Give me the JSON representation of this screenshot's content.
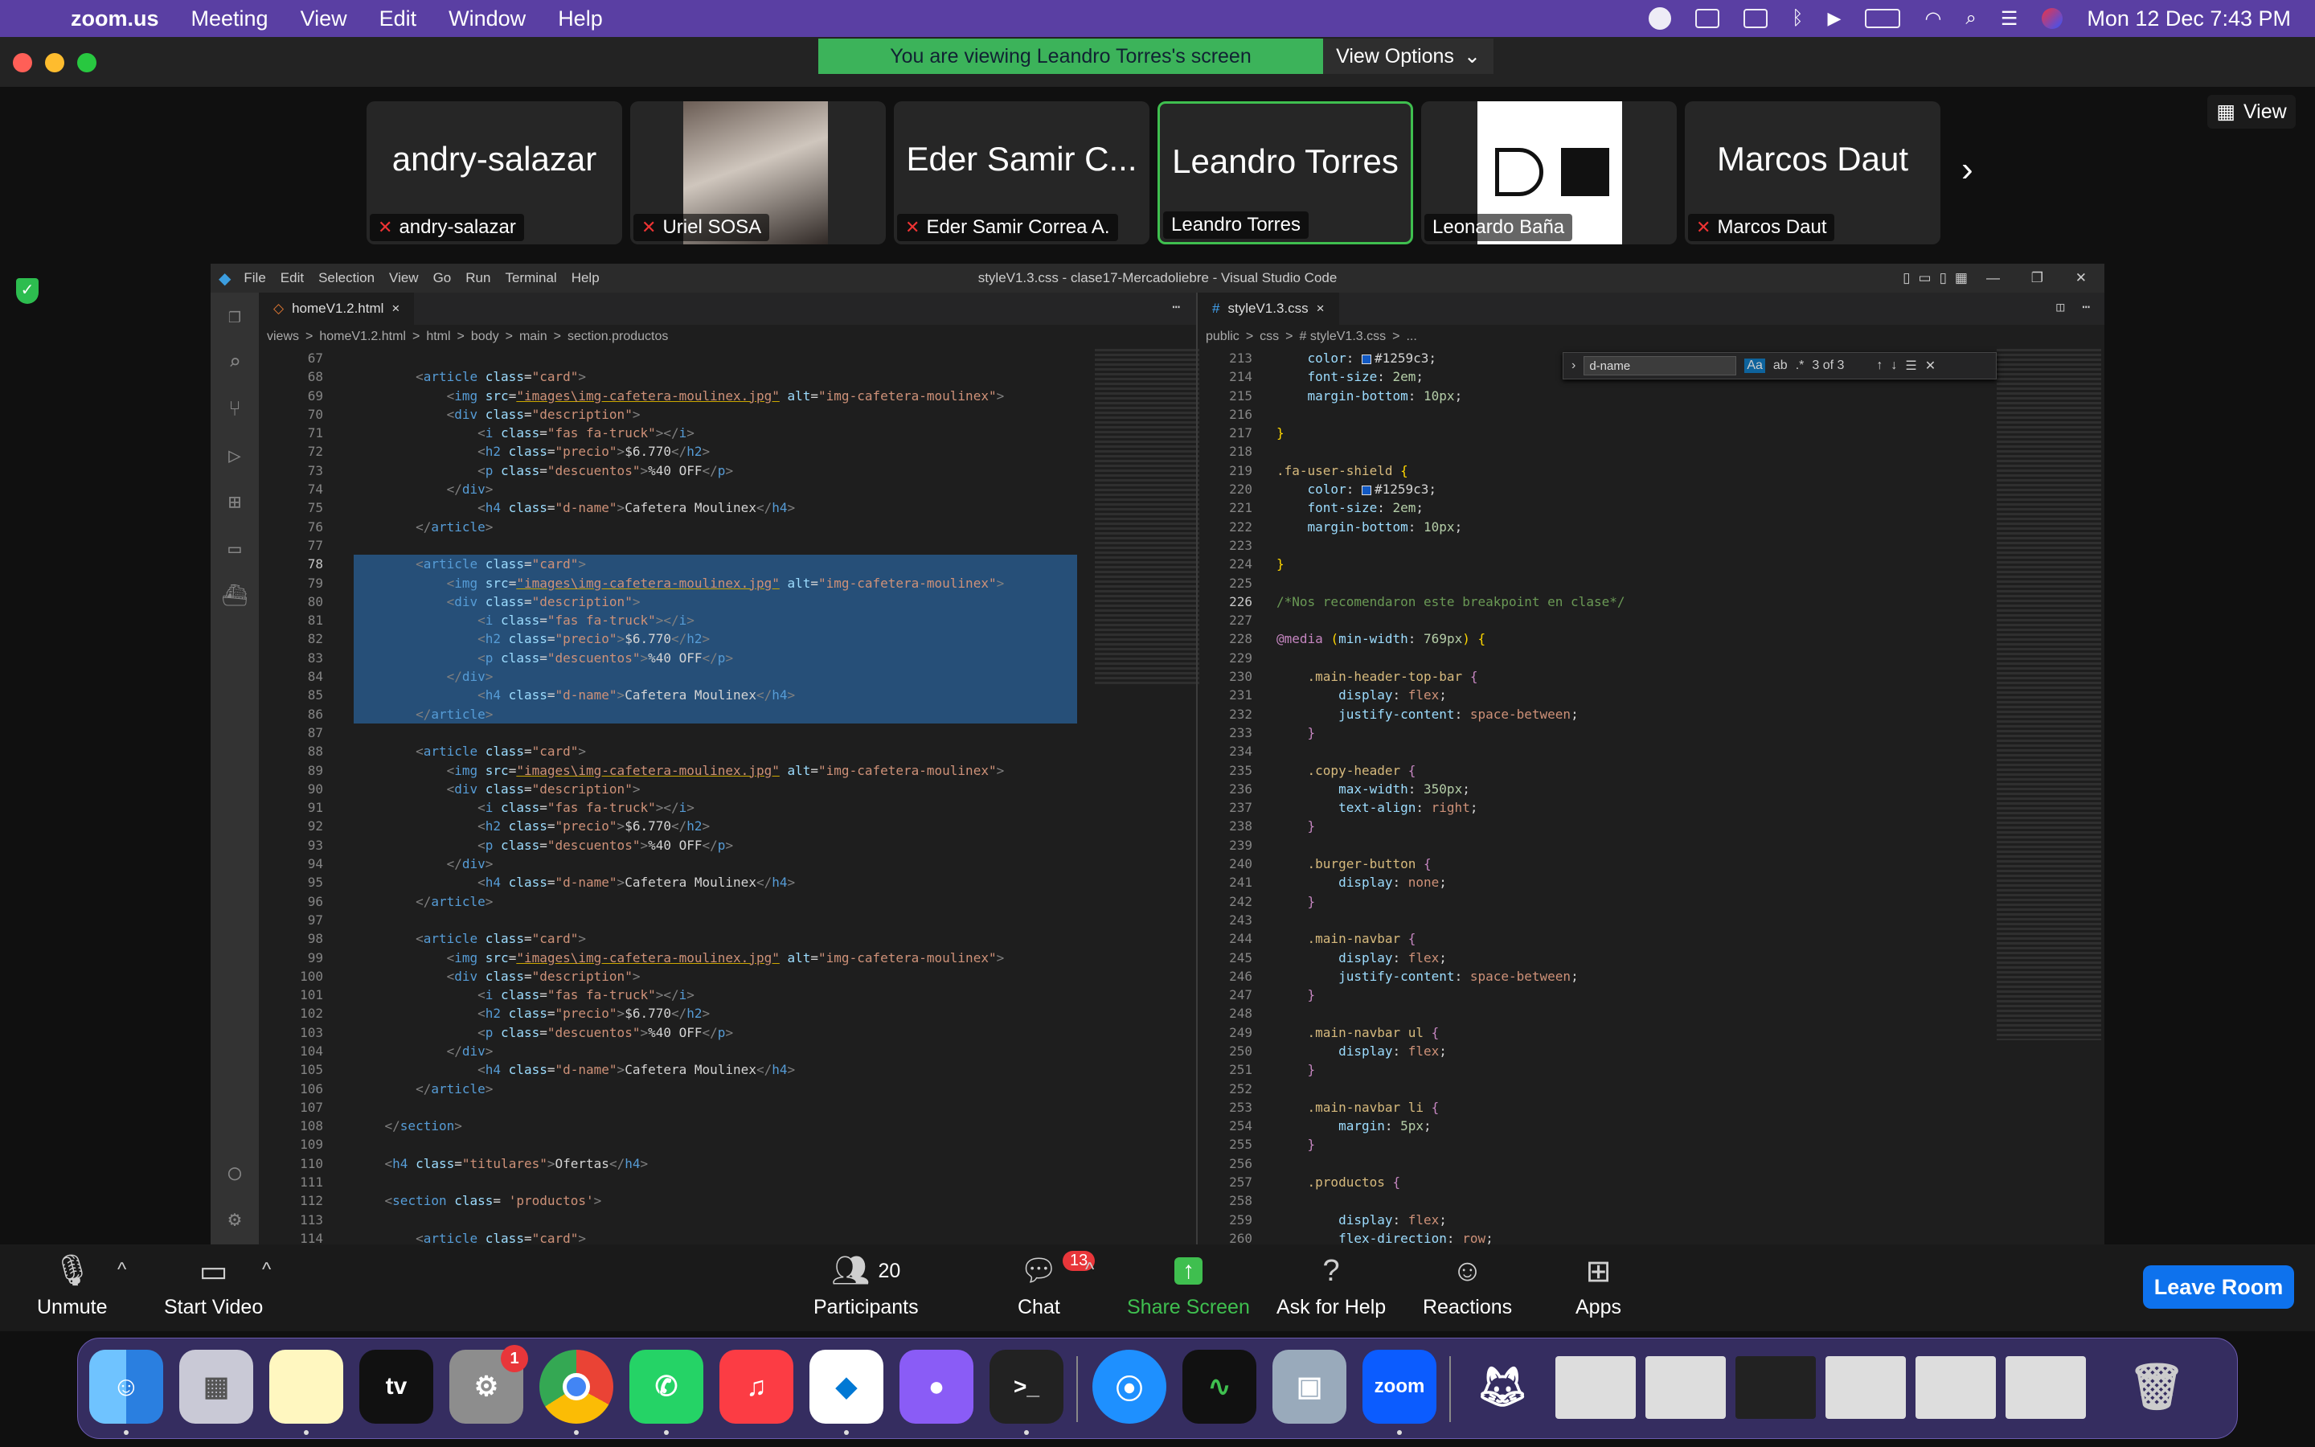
{
  "menubar": {
    "app": "zoom.us",
    "items": [
      "Meeting",
      "View",
      "Edit",
      "Window",
      "Help"
    ],
    "datetime": "Mon 12 Dec  7:43 PM"
  },
  "banner": {
    "message": "You are viewing Leandro Torres's screen",
    "options": "View Options"
  },
  "view_label": "View",
  "participants": [
    {
      "big": "andry-salazar",
      "label": "andry-salazar",
      "muted": true
    },
    {
      "big": "",
      "label": "Uriel SOSA",
      "muted": true
    },
    {
      "big": "Eder Samir C...",
      "label": "Eder Samir Correa A.",
      "muted": true
    },
    {
      "big": "Leandro Torres",
      "label": "Leandro Torres",
      "muted": false
    },
    {
      "big": "",
      "label": "Leonardo Baña",
      "muted": false
    },
    {
      "big": "Marcos Daut",
      "label": "Marcos Daut",
      "muted": true
    }
  ],
  "vscode": {
    "menu": [
      "File",
      "Edit",
      "Selection",
      "View",
      "Go",
      "Run",
      "Terminal",
      "Help"
    ],
    "title": "styleV1.3.css - clase17-Mercadoliebre - Visual Studio Code",
    "left_tab": "homeV1.2.html",
    "right_tab": "styleV1.3.css",
    "left_crumbs": [
      "views",
      ">",
      "homeV1.2.html",
      ">",
      "html",
      ">",
      "body",
      ">",
      "main",
      ">",
      "section.productos"
    ],
    "right_crumbs": [
      "public",
      ">",
      "css",
      ">",
      "# styleV1.3.css",
      ">",
      "..."
    ],
    "find": {
      "query": "d-name",
      "result": "3 of 3",
      "case": "Aa",
      "word": "ab"
    },
    "left_lines": [
      "67",
      "68",
      "69",
      "70",
      "71",
      "72",
      "73",
      "74",
      "75",
      "76",
      "77",
      "78",
      "79",
      "80",
      "81",
      "82",
      "83",
      "84",
      "85",
      "86",
      "87",
      "88",
      "89",
      "90",
      "91",
      "92",
      "93",
      "94",
      "95",
      "96",
      "97",
      "98",
      "99",
      "100",
      "101",
      "102",
      "103",
      "104",
      "105",
      "106",
      "107",
      "108",
      "109",
      "110",
      "111",
      "112",
      "113",
      "114"
    ],
    "right_lines": [
      "213",
      "214",
      "215",
      "216",
      "217",
      "218",
      "219",
      "220",
      "221",
      "222",
      "223",
      "224",
      "225",
      "226",
      "227",
      "228",
      "229",
      "230",
      "231",
      "232",
      "233",
      "234",
      "235",
      "236",
      "237",
      "238",
      "239",
      "240",
      "241",
      "242",
      "243",
      "244",
      "245",
      "246",
      "247",
      "248",
      "249",
      "250",
      "251",
      "252",
      "253",
      "254",
      "255",
      "256",
      "257",
      "258",
      "259",
      "260"
    ],
    "img_src": "images\\img-cafetera-moulinex.jpg",
    "img_alt": "img-cafetera-moulinex",
    "price": "$6.770",
    "discount": "%40 OFF",
    "product": "Cafetera Moulinex",
    "ofertas": "Ofertas",
    "css_comment": "/*Nos recomendaron este breakpoint en clase*/",
    "color_val": "#1259c3"
  },
  "toolbar": {
    "unmute": "Unmute",
    "video": "Start Video",
    "participants": "Participants",
    "participants_count": "20",
    "chat": "Chat",
    "chat_badge": "13",
    "share": "Share Screen",
    "help": "Ask for Help",
    "reactions": "Reactions",
    "apps": "Apps",
    "leave": "Leave Room"
  },
  "dock": {
    "settings_badge": "1",
    "tv": "tv",
    "zoom": "zoom"
  }
}
